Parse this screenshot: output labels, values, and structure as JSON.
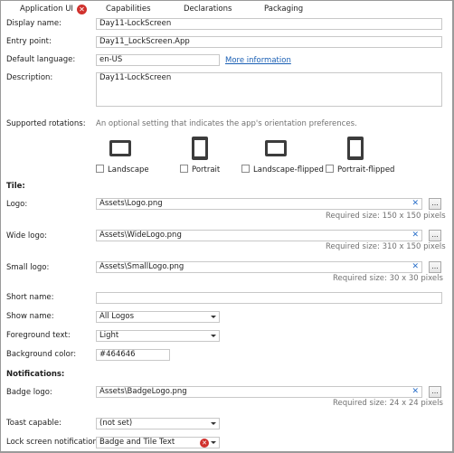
{
  "tabs": [
    {
      "label": "Application UI",
      "error": "✕"
    },
    {
      "label": "Capabilities"
    },
    {
      "label": "Declarations"
    },
    {
      "label": "Packaging"
    }
  ],
  "fields": {
    "display_name": {
      "label": "Display name:",
      "value": "Day11-LockScreen"
    },
    "entry_point": {
      "label": "Entry point:",
      "value": "Day11_LockScreen.App"
    },
    "default_language": {
      "label": "Default language:",
      "value": "en-US",
      "link": "More information"
    },
    "description": {
      "label": "Description:",
      "value": "Day11-LockScreen"
    }
  },
  "rotations": {
    "label": "Supported rotations:",
    "hint": "An optional setting that indicates the app's orientation preferences.",
    "options": [
      "Landscape",
      "Portrait",
      "Landscape-flipped",
      "Portrait-flipped"
    ]
  },
  "tile": {
    "heading": "Tile:",
    "logo": {
      "label": "Logo:",
      "value": "Assets\\Logo.png",
      "required": "Required size: 150 x 150 pixels"
    },
    "wide_logo": {
      "label": "Wide logo:",
      "value": "Assets\\WideLogo.png",
      "required": "Required size: 310 x 150 pixels"
    },
    "small_logo": {
      "label": "Small logo:",
      "value": "Assets\\SmallLogo.png",
      "required": "Required size: 30 x 30 pixels"
    },
    "short_name": {
      "label": "Short name:",
      "value": ""
    },
    "show_name": {
      "label": "Show name:",
      "value": "All Logos"
    },
    "foreground_text": {
      "label": "Foreground text:",
      "value": "Light"
    },
    "background_color": {
      "label": "Background color:",
      "value": "#464646"
    }
  },
  "notifications": {
    "heading": "Notifications:",
    "badge_logo": {
      "label": "Badge logo:",
      "value": "Assets\\BadgeLogo.png",
      "required": "Required size: 24 x 24 pixels"
    },
    "toast_capable": {
      "label": "Toast capable:",
      "value": "(not set)"
    },
    "lock_screen": {
      "label": "Lock screen notifications:",
      "value": "Badge and Tile Text",
      "error": "✕"
    }
  },
  "common": {
    "browse": "...",
    "clear": "✕"
  },
  "colors": {
    "error": "#d0312d",
    "link": "#1a5fb4",
    "clear": "#2a6fc9"
  }
}
